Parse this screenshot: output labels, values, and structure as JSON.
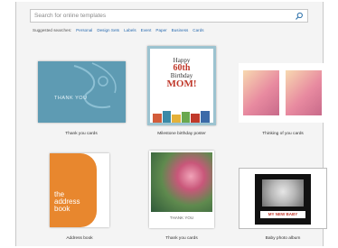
{
  "search": {
    "placeholder": "Search for online templates"
  },
  "suggested": {
    "label": "Suggested searches:",
    "categories": [
      "Personal",
      "Design Sets",
      "Labels",
      "Event",
      "Paper",
      "Business",
      "Cards"
    ]
  },
  "templates": [
    {
      "caption": "Thank you cards",
      "thumb_text": "THANK YOU"
    },
    {
      "caption": "Milestone birthday poster",
      "thumb_text": [
        "Happy",
        "60th",
        "Birthday",
        "MOM!"
      ]
    },
    {
      "caption": "Thinking of you cards",
      "thumb_text": ""
    },
    {
      "caption": "Address book",
      "thumb_text": [
        "the",
        "address",
        "book"
      ]
    },
    {
      "caption": "Thank you cards",
      "thumb_text": "THANK YOU"
    },
    {
      "caption": "Baby photo album",
      "thumb_text": "MY NEW BABY"
    }
  ],
  "colors": {
    "accent_link": "#2b6cb0",
    "teal_card": "#5e9bb3",
    "orange_book": "#e8872e"
  }
}
